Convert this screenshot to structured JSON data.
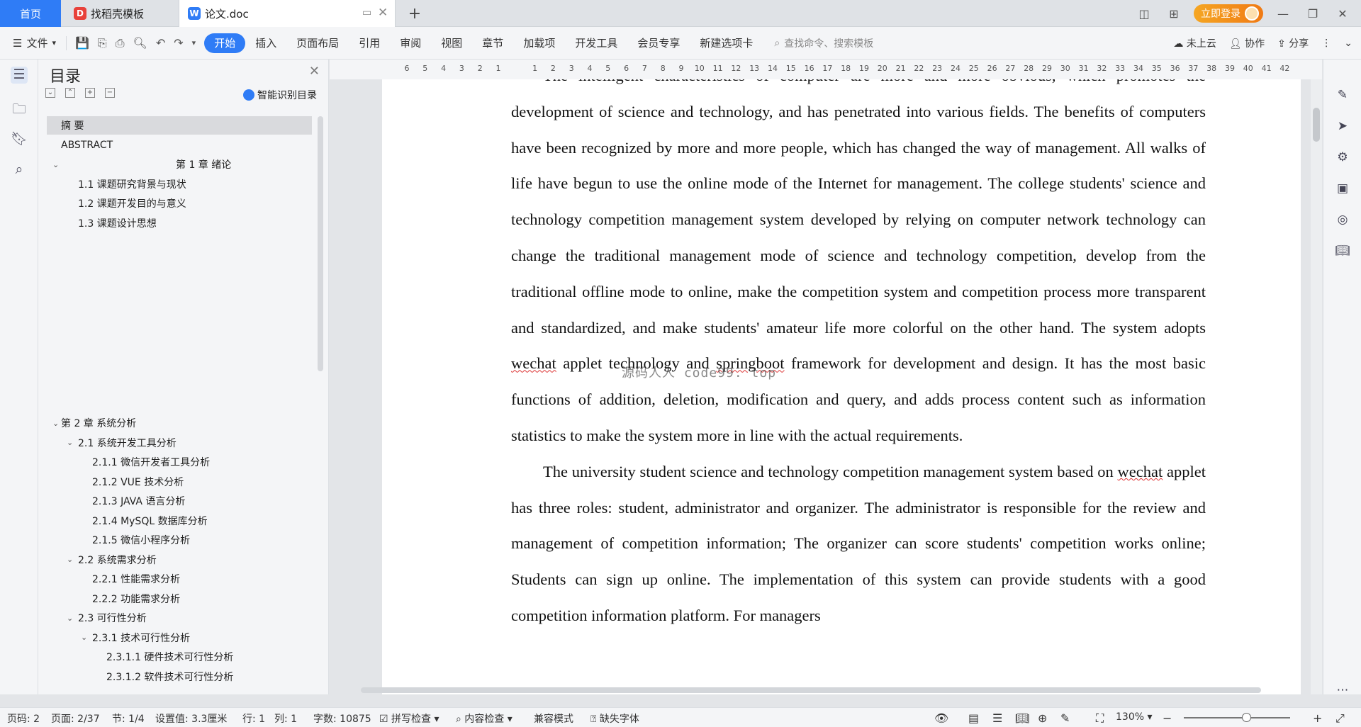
{
  "tabs": {
    "home": "首页",
    "template": "找稻壳模板",
    "doc": "论文.doc",
    "new_tab": "+"
  },
  "titlebar": {
    "login": "立即登录"
  },
  "ribbon": {
    "file": "文件",
    "tabs": [
      "开始",
      "插入",
      "页面布局",
      "引用",
      "审阅",
      "视图",
      "章节",
      "加载项",
      "开发工具",
      "会员专享",
      "新建选项卡"
    ],
    "search_placeholder": "查找命令、搜索模板",
    "cloud": "未上云",
    "collab": "协作",
    "share": "分享"
  },
  "toc": {
    "title": "目录",
    "smart": "智能识别目录",
    "items": [
      {
        "label": "摘  要",
        "level": 0
      },
      {
        "label": "ABSTRACT",
        "level": 0
      },
      {
        "label": "第 1 章  绪论",
        "level": 0
      },
      {
        "label": "1.1  课题研究背景与现状",
        "level": 1
      },
      {
        "label": "1.2 课题开发目的与意义",
        "level": 1
      },
      {
        "label": "1.3  课题设计思想",
        "level": 1
      },
      {
        "label": "第 2 章  系统分析",
        "level": 0
      },
      {
        "label": "2.1  系统开发工具分析",
        "level": 1
      },
      {
        "label": "2.1.1  微信开发者工具分析",
        "level": 2
      },
      {
        "label": "2.1.2  VUE 技术分析",
        "level": 2
      },
      {
        "label": "2.1.3  JAVA 语言分析",
        "level": 2
      },
      {
        "label": "2.1.4  MySQL 数据库分析",
        "level": 2
      },
      {
        "label": "2.1.5  微信小程序分析",
        "level": 2
      },
      {
        "label": "2.2 系统需求分析",
        "level": 1
      },
      {
        "label": "2.2.1  性能需求分析",
        "level": 2
      },
      {
        "label": "2.2.2  功能需求分析",
        "level": 2
      },
      {
        "label": "2.3 可行性分析",
        "level": 1
      },
      {
        "label": "2.3.1  技术可行性分析",
        "level": 2
      },
      {
        "label": "2.3.1.1 硬件技术可行性分析",
        "level": 3
      },
      {
        "label": "2.3.1.2 软件技术可行性分析",
        "level": 3
      }
    ]
  },
  "ruler": {
    "numbers": [
      "6",
      "5",
      "4",
      "3",
      "2",
      "1",
      "",
      "1",
      "2",
      "3",
      "4",
      "5",
      "6",
      "7",
      "8",
      "9",
      "10",
      "11",
      "12",
      "13",
      "14",
      "15",
      "16",
      "17",
      "18",
      "19",
      "20",
      "21",
      "22",
      "23",
      "24",
      "25",
      "26",
      "27",
      "28",
      "29",
      "30",
      "31",
      "32",
      "33",
      "34",
      "35",
      "36",
      "37",
      "38",
      "39",
      "40",
      "41",
      "42"
    ]
  },
  "document": {
    "p1_a": "The intelligent characteristics of computer are more and more obvious, which promotes the development of science and technology, and has penetrated into various fields. The benefits of computers have been recognized by more and more people, which has changed the way of management. All walks of life have begun to use the online mode of the Internet for management. The college students' science and technology competition management system developed by relying on computer network technology can change the traditional management mode of science and technology competition, develop from the traditional offline mode to online, make the competition system and competition process more transparent and standardized, and make students' amateur life more colorful on the other hand. The system adopts ",
    "p1_w1": "wechat",
    "p1_b": " applet technology and ",
    "p1_w2": "springboot",
    "p1_c": " framework for development and design. It has the most basic functions of addition, deletion, modification and query, and adds process content such as information statistics to make the system more in line with the actual requirements.",
    "p2_a": "The university student science and technology competition management system based on ",
    "p2_w1": "wechat",
    "p2_b": " applet has three roles: student, administrator and organizer. The administrator is responsible for the review and management of competition information; The organizer can score students' competition works online; Students can sign up online. The implementation of this system can provide students with a good competition information platform. For managers",
    "watermark": "源码人人 code99. top"
  },
  "status": {
    "page_num": "页码: 2",
    "pages": "页面: 2/37",
    "section": "节: 1/4",
    "setting": "设置值: 3.3厘米",
    "row": "行: 1",
    "col": "列: 1",
    "words": "字数: 10875",
    "spell": "拼写检查",
    "content": "内容检查",
    "compat": "兼容模式",
    "missing_font": "缺失字体",
    "zoom": "130%"
  }
}
